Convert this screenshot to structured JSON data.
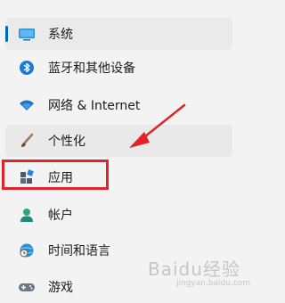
{
  "nav": {
    "items": [
      {
        "label": "系统",
        "icon": "monitor-icon"
      },
      {
        "label": "蓝牙和其他设备",
        "icon": "bluetooth-icon"
      },
      {
        "label": "网络 & Internet",
        "icon": "wifi-icon"
      },
      {
        "label": "个性化",
        "icon": "brush-icon"
      },
      {
        "label": "应用",
        "icon": "apps-icon"
      },
      {
        "label": "帐户",
        "icon": "account-icon"
      },
      {
        "label": "时间和语言",
        "icon": "globe-clock-icon"
      },
      {
        "label": "游戏",
        "icon": "gamepad-icon"
      }
    ]
  },
  "watermark": {
    "text": "Baidu经验",
    "sub": "jingyan.baidu.com"
  },
  "colors": {
    "accent": "#0067c0",
    "highlight": "#e0242a"
  }
}
